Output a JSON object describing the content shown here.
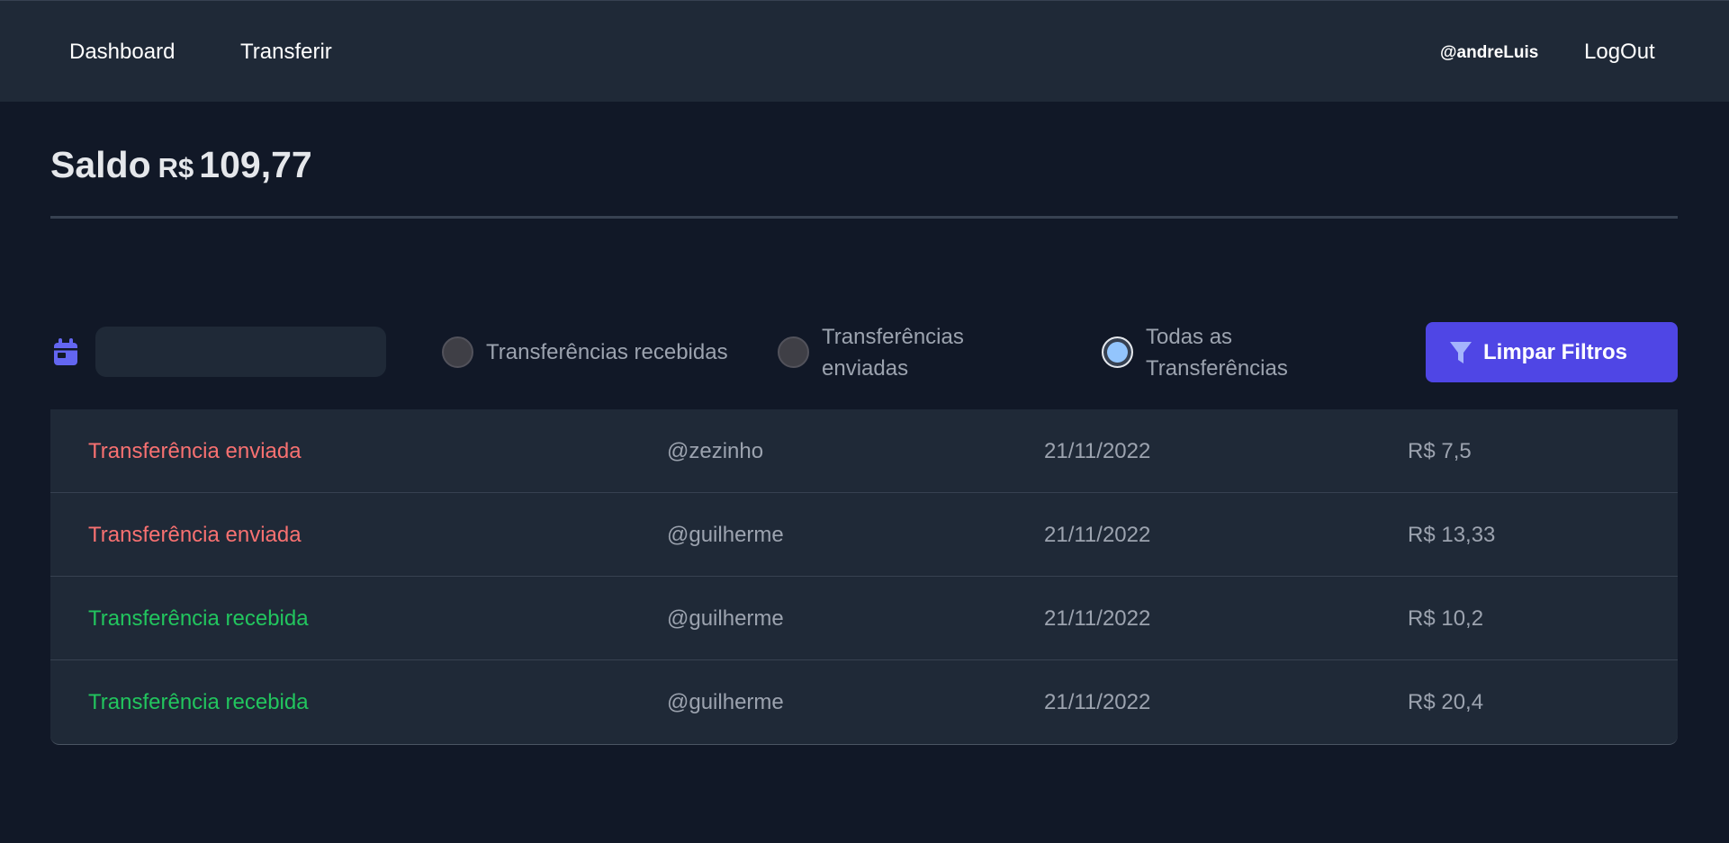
{
  "nav": {
    "dashboard": "Dashboard",
    "transfer": "Transferir",
    "username": "@andreLuis",
    "logout": "LogOut"
  },
  "balance": {
    "label": "Saldo",
    "currency": "R$",
    "value": "109,77"
  },
  "filters": {
    "date_value": "",
    "radio_received": "Transferências recebidas",
    "radio_sent": "Transferências enviadas",
    "radio_all": "Todas as Transferências",
    "selected": "all",
    "clear_label": "Limpar Filtros"
  },
  "transactions": [
    {
      "type": "Transferência enviada",
      "kind": "sent",
      "user": "@zezinho",
      "date": "21/11/2022",
      "amount": "R$ 7,5"
    },
    {
      "type": "Transferência enviada",
      "kind": "sent",
      "user": "@guilherme",
      "date": "21/11/2022",
      "amount": "R$ 13,33"
    },
    {
      "type": "Transferência recebida",
      "kind": "received",
      "user": "@guilherme",
      "date": "21/11/2022",
      "amount": "R$ 10,2"
    },
    {
      "type": "Transferência recebida",
      "kind": "received",
      "user": "@guilherme",
      "date": "21/11/2022",
      "amount": "R$ 20,4"
    }
  ],
  "colors": {
    "sent": "#f87171",
    "received": "#22c55e",
    "accent": "#4f46e5",
    "background": "#111827",
    "panel": "#1f2937"
  },
  "icons": {
    "calendar": "calendar-icon",
    "filter": "filter-icon"
  }
}
